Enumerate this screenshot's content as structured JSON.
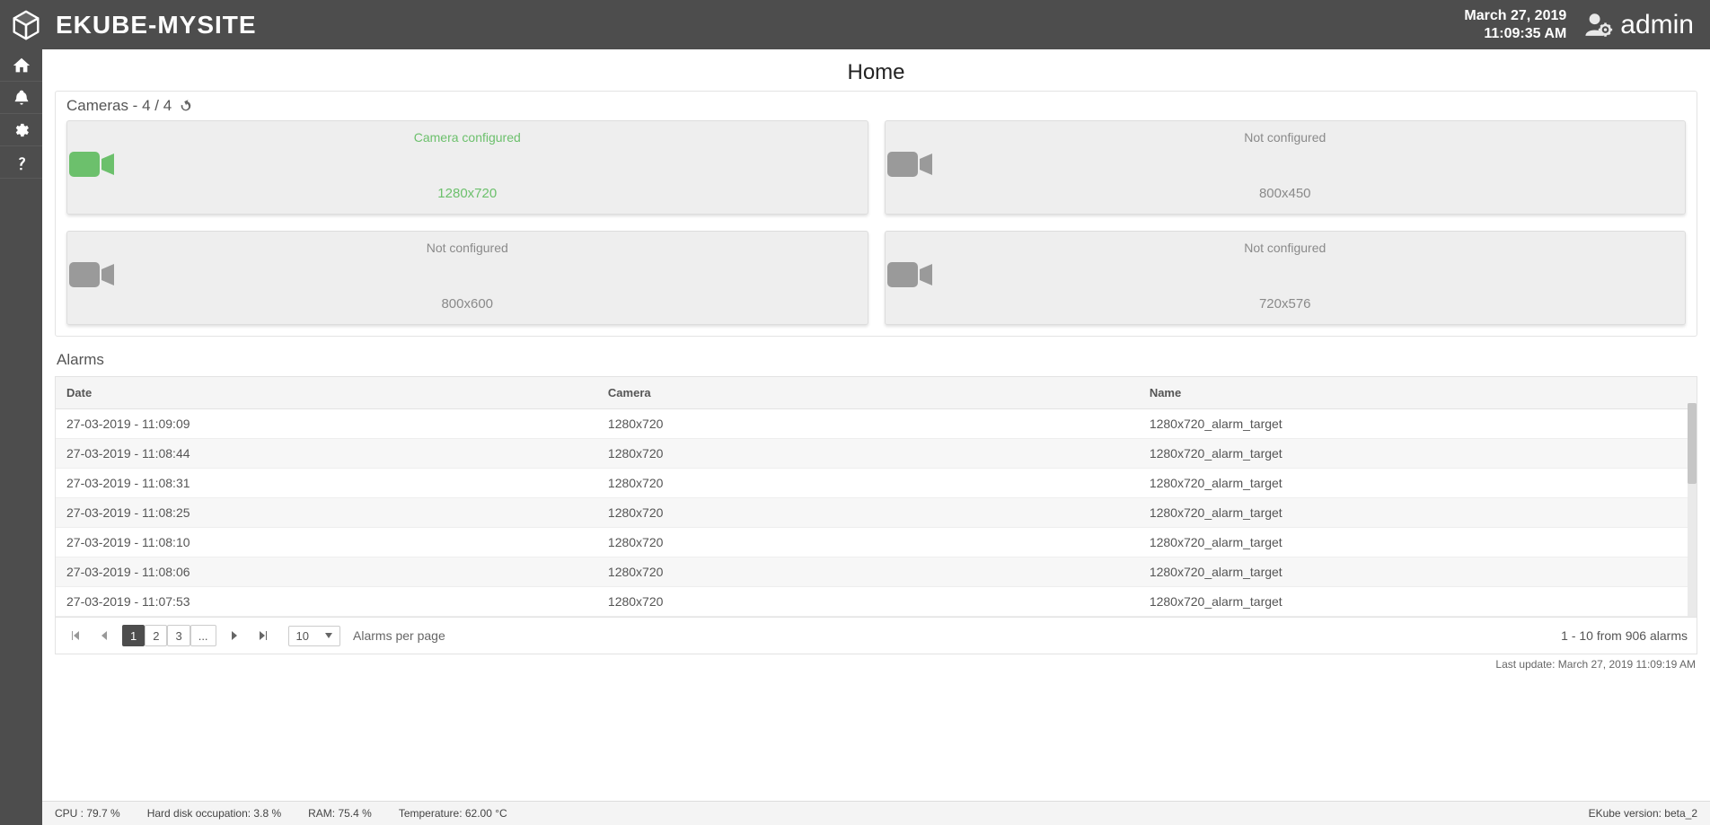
{
  "header": {
    "site_title": "EKUBE-MYSITE",
    "date": "March 27, 2019",
    "time": "11:09:35 AM",
    "user": "admin"
  },
  "page": {
    "title": "Home"
  },
  "cameras_panel": {
    "title": "Cameras - 4 / 4",
    "cards": [
      {
        "status": "Camera configured",
        "resolution": "1280x720",
        "ok": true
      },
      {
        "status": "Not configured",
        "resolution": "800x450",
        "ok": false
      },
      {
        "status": "Not configured",
        "resolution": "800x600",
        "ok": false
      },
      {
        "status": "Not configured",
        "resolution": "720x576",
        "ok": false
      }
    ]
  },
  "alarms_panel": {
    "title": "Alarms",
    "columns": {
      "date": "Date",
      "camera": "Camera",
      "name": "Name"
    },
    "rows": [
      {
        "date": "27-03-2019 - 11:09:09",
        "camera": "1280x720",
        "name": "1280x720_alarm_target"
      },
      {
        "date": "27-03-2019 - 11:08:44",
        "camera": "1280x720",
        "name": "1280x720_alarm_target"
      },
      {
        "date": "27-03-2019 - 11:08:31",
        "camera": "1280x720",
        "name": "1280x720_alarm_target"
      },
      {
        "date": "27-03-2019 - 11:08:25",
        "camera": "1280x720",
        "name": "1280x720_alarm_target"
      },
      {
        "date": "27-03-2019 - 11:08:10",
        "camera": "1280x720",
        "name": "1280x720_alarm_target"
      },
      {
        "date": "27-03-2019 - 11:08:06",
        "camera": "1280x720",
        "name": "1280x720_alarm_target"
      },
      {
        "date": "27-03-2019 - 11:07:53",
        "camera": "1280x720",
        "name": "1280x720_alarm_target"
      }
    ],
    "pager": {
      "pages": [
        "1",
        "2",
        "3",
        "..."
      ],
      "active": "1",
      "page_size": "10",
      "label": "Alarms per page",
      "info": "1 - 10 from 906 alarms"
    },
    "last_update": "Last update: March 27, 2019 11:09:19 AM"
  },
  "footer": {
    "cpu": "CPU : 79.7 %",
    "disk": "Hard disk occupation: 3.8 %",
    "ram": "RAM: 75.4 %",
    "temp": "Temperature: 62.00 °C",
    "version": "EKube version: beta_2"
  }
}
